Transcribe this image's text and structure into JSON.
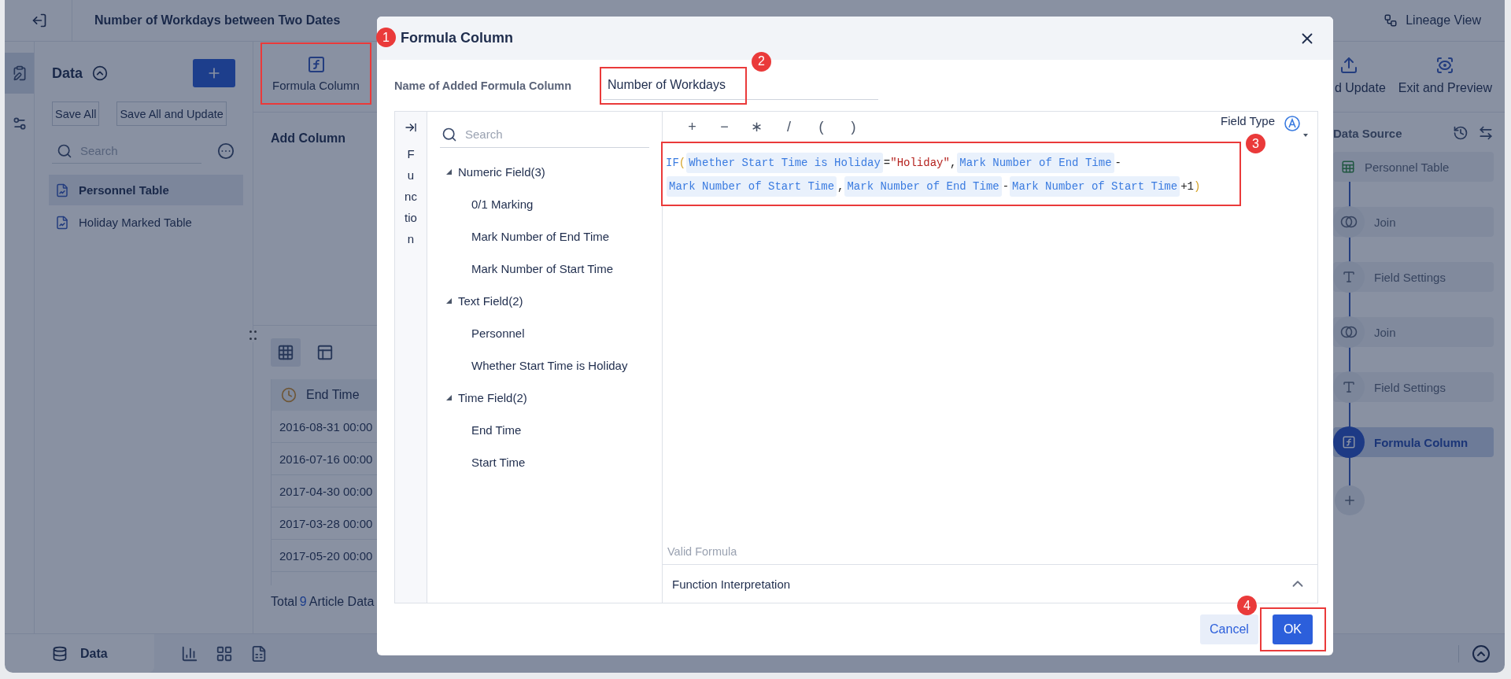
{
  "app": {
    "title": "Number of Workdays between Two Dates",
    "lineage_button": "Lineage View"
  },
  "rail": [
    {
      "kind": "data",
      "selected": true
    },
    {
      "kind": "settings",
      "selected": false
    }
  ],
  "data_panel": {
    "title": "Data",
    "buttons": [
      "Save All",
      "Save All and Update"
    ],
    "search_placeholder": "Search",
    "tables": [
      {
        "label": "Personnel Table",
        "selected": true
      },
      {
        "label": "Holiday Marked Table",
        "selected": false
      }
    ]
  },
  "toolbar": {
    "formula_button": {
      "label": "Formula Column",
      "badge": "1"
    },
    "right_buttons": [
      {
        "kind": "update",
        "label": "d Update"
      },
      {
        "kind": "preview",
        "label": "Exit and Preview"
      }
    ]
  },
  "add_column_label": "Add Column",
  "views": [
    {
      "kind": "grid",
      "selected": true
    },
    {
      "kind": "layout",
      "selected": false
    }
  ],
  "table": {
    "columns": [
      "End Time"
    ],
    "rows": [
      [
        "2016-08-31 00:00"
      ],
      [
        "2016-07-16 00:00"
      ],
      [
        "2017-04-30 00:00"
      ],
      [
        "2017-03-28 00:00"
      ],
      [
        "2017-05-20 00:00"
      ]
    ]
  },
  "total": {
    "label": "Total",
    "count": "9",
    "suffix": "Article Data"
  },
  "data_source": {
    "title": "Data Source",
    "nodes": [
      {
        "kind": "source",
        "label": "Personnel Table",
        "selected": false
      },
      {
        "kind": "join",
        "label": "Join",
        "selected": false
      },
      {
        "kind": "field_settings",
        "label": "Field Settings",
        "selected": false
      },
      {
        "kind": "join",
        "label": "Join",
        "selected": false
      },
      {
        "kind": "field_settings",
        "label": "Field Settings",
        "selected": false
      },
      {
        "kind": "formula",
        "label": "Formula Column",
        "selected": true
      }
    ]
  },
  "bottom_bar": {
    "tab": "Data"
  },
  "dialog": {
    "title": "Formula Column",
    "name_label": "Name of Added Formula Column",
    "name_value": "Number of Workdays",
    "name_badge": "2",
    "function_tab": "Function",
    "field_search_placeholder": "Search",
    "field_groups": [
      {
        "label": "Numeric Field(3)",
        "expanded": true,
        "children": [
          {
            "label": "0/1 Marking"
          },
          {
            "label": "Mark Number of End Time"
          },
          {
            "label": "Mark Number of Start Time"
          }
        ]
      },
      {
        "label": "Text Field(2)",
        "expanded": true,
        "children": [
          {
            "label": "Personnel"
          },
          {
            "label": "Whether Start Time is Holiday"
          }
        ]
      },
      {
        "label": "Time Field(2)",
        "expanded": true,
        "children": [
          {
            "label": "End Time"
          },
          {
            "label": "Start Time"
          }
        ]
      }
    ],
    "operators": [
      "+",
      "−",
      "∗",
      "/",
      "(",
      ")"
    ],
    "field_type_label": "Field Type",
    "formula": {
      "badge": "3",
      "tokens": [
        {
          "kind": "func",
          "text": "IF"
        },
        {
          "kind": "paren",
          "text": "("
        },
        {
          "kind": "field",
          "text": "Whether Start Time is Holiday"
        },
        {
          "kind": "op",
          "text": "="
        },
        {
          "kind": "string",
          "text": "\"Holiday\""
        },
        {
          "kind": "op",
          "text": ","
        },
        {
          "kind": "field",
          "text": "Mark Number of End Time"
        },
        {
          "kind": "op",
          "text": "-"
        },
        {
          "kind": "field",
          "text": "Mark Number of Start Time"
        },
        {
          "kind": "op",
          "text": ","
        },
        {
          "kind": "field",
          "text": "Mark Number of End Time"
        },
        {
          "kind": "op",
          "text": "-"
        },
        {
          "kind": "field",
          "text": "Mark Number of Start Time"
        },
        {
          "kind": "op",
          "text": "+1"
        },
        {
          "kind": "paren",
          "text": ")"
        }
      ]
    },
    "status": "Valid Formula",
    "interpretation": {
      "label": "Function Interpretation",
      "expanded": false
    },
    "buttons": [
      {
        "kind": "cancel",
        "label": "Cancel"
      },
      {
        "kind": "ok",
        "label": "OK",
        "badge": "4"
      }
    ]
  }
}
